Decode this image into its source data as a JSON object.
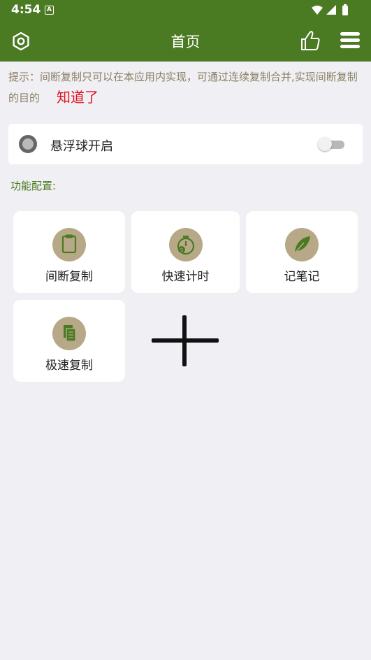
{
  "status_bar": {
    "time": "4:54",
    "notification_letter": "A"
  },
  "app_bar": {
    "title": "首页",
    "left_icon": "settings-hexagon-icon",
    "right_icons": [
      "thumbs-up-icon",
      "menu-icon"
    ]
  },
  "hint": {
    "text": "提示：间断复制只可以在本应用内实现，可通过连续复制合并,实现间断复制的目的",
    "dismiss_label": "知道了"
  },
  "float_ball": {
    "label": "悬浮球开启",
    "enabled": false
  },
  "functions": {
    "section_label": "功能配置:",
    "items": [
      {
        "label": "间断复制",
        "icon": "clipboard-icon"
      },
      {
        "label": "快速计时",
        "icon": "stopwatch-icon"
      },
      {
        "label": "记笔记",
        "icon": "feather-icon"
      },
      {
        "label": "极速复制",
        "icon": "copy-documents-icon"
      }
    ],
    "add_icon": "plus-icon"
  },
  "colors": {
    "primary": "#4a7a22",
    "hint_text": "#8a7d62",
    "dismiss": "#e01020",
    "icon_circle": "#b7a987",
    "background": "#f0f0f4"
  }
}
